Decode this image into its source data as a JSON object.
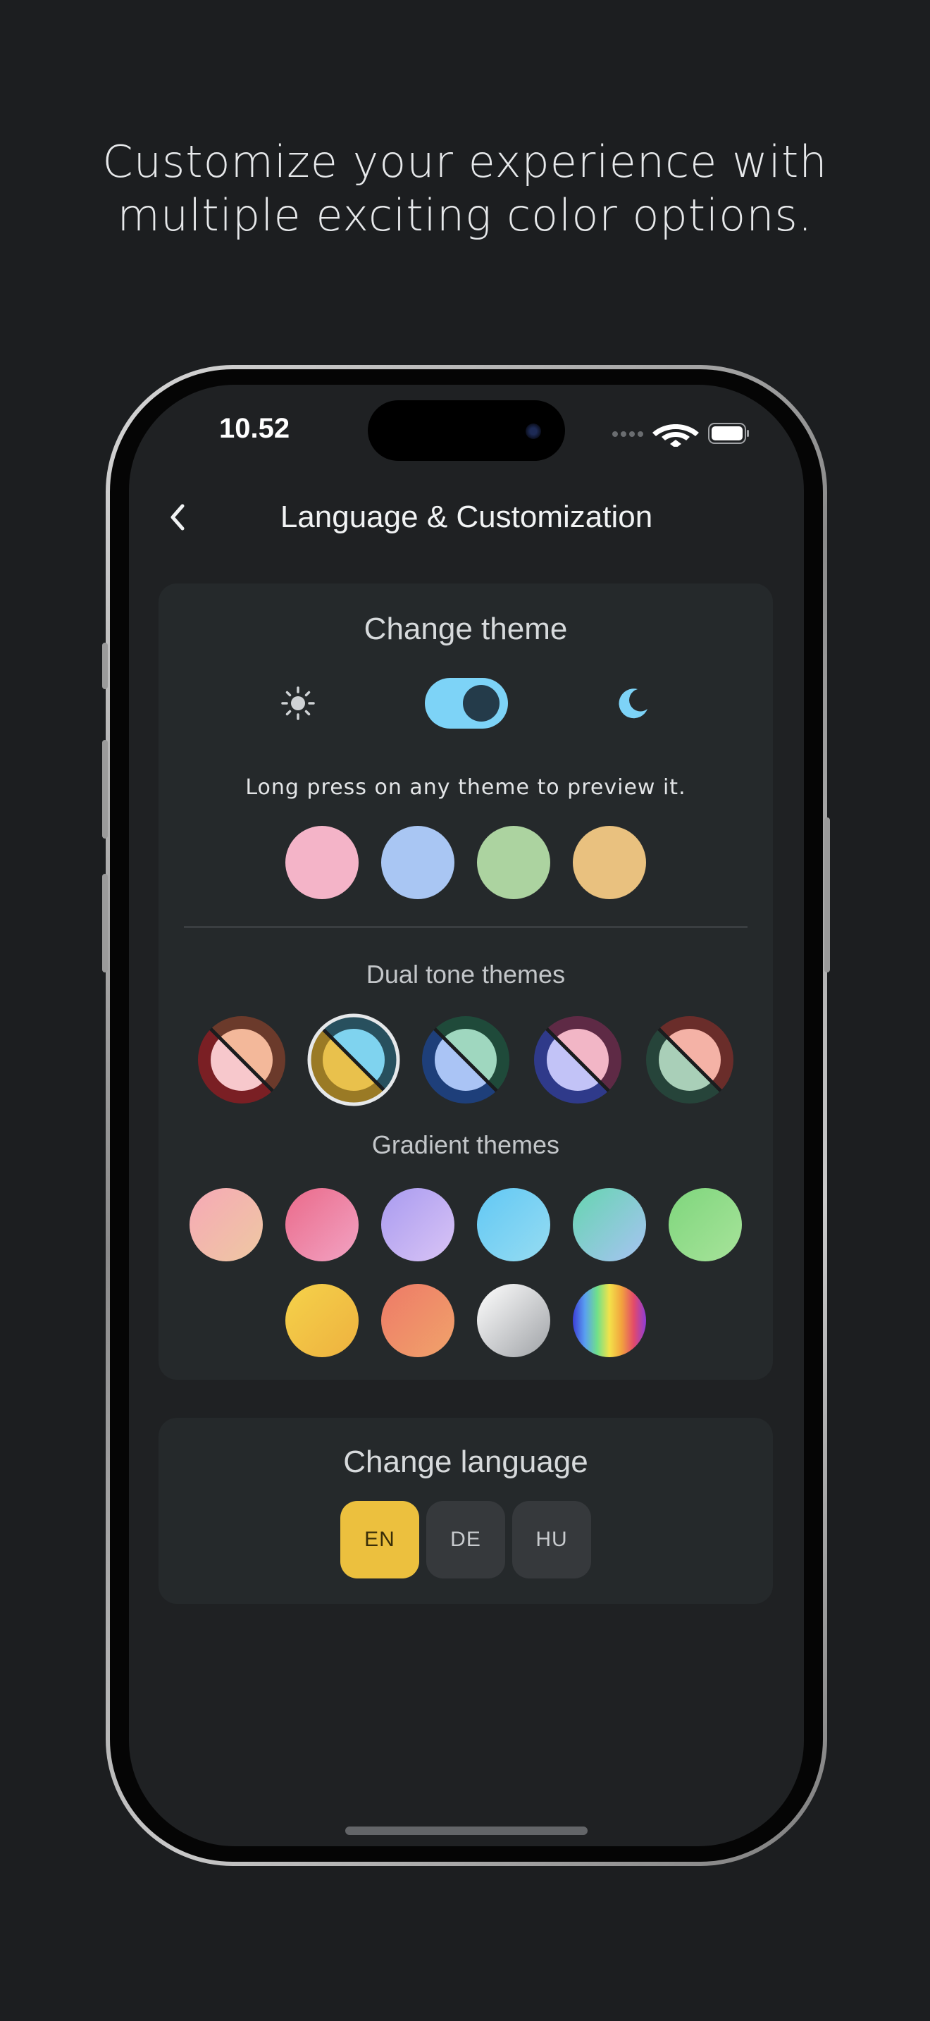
{
  "promo": {
    "line1": "Customize your experience with",
    "line2": "multiple exciting color options."
  },
  "status_bar": {
    "time": "10.52",
    "icons": [
      "signal-dots-icon",
      "wifi-icon",
      "battery-icon"
    ]
  },
  "nav": {
    "back_icon": "chevron-left-icon",
    "title": "Language & Customization"
  },
  "theme_card": {
    "title": "Change theme",
    "mode_toggle": {
      "left_icon": "sun-icon",
      "right_icon": "moon-icon",
      "state": "dark"
    },
    "hint": "Long press on any theme to preview it.",
    "solid_themes": [
      "#f4b4c8",
      "#a9c6f3",
      "#acd3a0",
      "#e9c17f"
    ],
    "dual_title": "Dual tone themes",
    "dual_themes": [
      {
        "outer_a": "#6b3a2b",
        "outer_b": "#7a1f24",
        "inner_a": "#f3b89a",
        "inner_b": "#f7c8cc",
        "selected": false
      },
      {
        "outer_a": "#28505e",
        "outer_b": "#9a7a25",
        "inner_a": "#7fd3ef",
        "inner_b": "#e9c14c",
        "selected": true
      },
      {
        "outer_a": "#1f4a3a",
        "outer_b": "#1e3f7a",
        "inner_a": "#9fd7bf",
        "inner_b": "#aac4f5",
        "selected": false
      },
      {
        "outer_a": "#5e2a45",
        "outer_b": "#2f3a8a",
        "inner_a": "#f2b6c6",
        "inner_b": "#c2c3f7",
        "selected": false
      },
      {
        "outer_a": "#6a2d2a",
        "outer_b": "#26443a",
        "inner_a": "#f4b2a6",
        "inner_b": "#a9cfb8",
        "selected": false
      }
    ],
    "gradient_title": "Gradient themes",
    "gradient_themes_row1": [
      [
        "#f6a9b6",
        "#eec8a2"
      ],
      [
        "#ea6a8a",
        "#f2a3c3"
      ],
      [
        "#a99bf0",
        "#d9c4f5"
      ],
      [
        "#62c8f4",
        "#96dcf2"
      ],
      [
        "#66d5b0",
        "#a7c3f3"
      ],
      [
        "#7fd67d",
        "#a7e39a"
      ]
    ],
    "gradient_themes_row2": [
      [
        "#f5d24a",
        "#eeb13f"
      ],
      [
        "#ee7a68",
        "#f0a36a"
      ],
      [
        "#ffffff",
        "#9fa2a6"
      ],
      [
        "rainbow",
        "rainbow"
      ]
    ]
  },
  "language_card": {
    "title": "Change language",
    "options": [
      {
        "code": "EN",
        "active": true
      },
      {
        "code": "DE",
        "active": false
      },
      {
        "code": "HU",
        "active": false
      }
    ],
    "active_color": "#ecc03e",
    "inactive_color": "#36393c"
  }
}
